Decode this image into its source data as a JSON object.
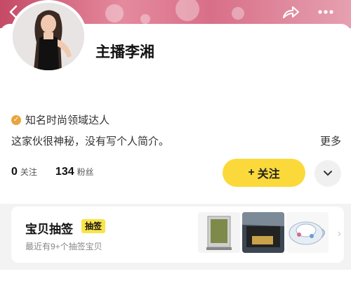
{
  "header": {
    "back_icon": "back-icon",
    "share_icon": "share-icon",
    "more_icon": "more-icon"
  },
  "profile": {
    "name": "主播李湘",
    "badge_text": "知名时尚领域达人",
    "bio": "这家伙很神秘，没有写个人简介。",
    "more_label": "更多",
    "following_count": "0",
    "following_label": "关注",
    "fans_count": "134",
    "fans_label": "粉丝",
    "follow_button_label": "关注",
    "follow_plus": "+"
  },
  "lottery_panel": {
    "title": "宝贝抽签",
    "tag": "抽签",
    "subtitle": "最近有9+个抽签宝贝"
  },
  "colors": {
    "accent": "#fbd93a",
    "verified": "#e9a53a"
  }
}
